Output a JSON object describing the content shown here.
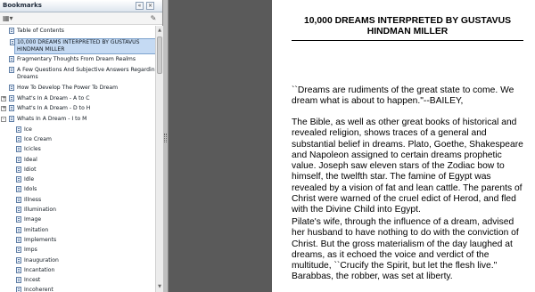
{
  "bookmarks": {
    "title": "Bookmarks",
    "items": [
      {
        "label": "Table of Contents",
        "level": 0,
        "expander": ""
      },
      {
        "label": "10,000 DREAMS INTERPRETED BY GUSTAVUS\nHINDMAN MILLER",
        "level": 0,
        "expander": "",
        "selected": true
      },
      {
        "label": "Fragmentary Thoughts From Dream Realms",
        "level": 0,
        "expander": ""
      },
      {
        "label": "A Few Questions And Subjective Answers Regarding\nDreams",
        "level": 0,
        "expander": ""
      },
      {
        "label": "How To Develop The Power To Dream",
        "level": 0,
        "expander": ""
      },
      {
        "label": "What's In A Dream - A to C",
        "level": 0,
        "expander": "+"
      },
      {
        "label": "What's In A Dream - D to H",
        "level": 0,
        "expander": "+"
      },
      {
        "label": "Whats In A Dream - I to M",
        "level": 0,
        "expander": "-"
      },
      {
        "label": "Ice",
        "level": 1,
        "expander": ""
      },
      {
        "label": "Ice Cream",
        "level": 1,
        "expander": ""
      },
      {
        "label": "Icicles",
        "level": 1,
        "expander": ""
      },
      {
        "label": "Ideal",
        "level": 1,
        "expander": ""
      },
      {
        "label": "Idiot",
        "level": 1,
        "expander": ""
      },
      {
        "label": "Idle",
        "level": 1,
        "expander": ""
      },
      {
        "label": "Idols",
        "level": 1,
        "expander": ""
      },
      {
        "label": "Illness",
        "level": 1,
        "expander": ""
      },
      {
        "label": "Illumination",
        "level": 1,
        "expander": ""
      },
      {
        "label": "Image",
        "level": 1,
        "expander": ""
      },
      {
        "label": "Imitation",
        "level": 1,
        "expander": ""
      },
      {
        "label": "Implements",
        "level": 1,
        "expander": ""
      },
      {
        "label": "Imps",
        "level": 1,
        "expander": ""
      },
      {
        "label": "Inauguration",
        "level": 1,
        "expander": ""
      },
      {
        "label": "Incantation",
        "level": 1,
        "expander": ""
      },
      {
        "label": "Incest",
        "level": 1,
        "expander": ""
      },
      {
        "label": "Incoherent",
        "level": 1,
        "expander": ""
      }
    ]
  },
  "document": {
    "title": "10,000 DREAMS INTERPRETED BY GUSTAVUS\nHINDMAN MILLER",
    "paragraphs": [
      "``Dreams are rudiments of the great state to come. We\ndream what is about to happen.\"--BAILEY,",
      "The Bible, as well as other great books of historical and\nrevealed religion, shows traces of a general and\nsubstantial belief in dreams. Plato, Goethe, Shakespeare\nand Napoleon assigned to certain dreams prophetic\nvalue. Joseph saw eleven stars of the Zodiac bow to\nhimself, the twelfth star. The famine of Egypt was\nrevealed by a vision of fat and lean cattle. The parents of\nChrist were warned of the cruel edict of Herod, and fled\nwith the Divine Child into Egypt.",
      "Pilate's wife, through the influence of a dream, advised\nher husband to have nothing to do with the conviction of\nChrist. But the gross materialism of the day laughed at\ndreams, as it echoed the voice and verdict of the\nmultitude, ``Crucify the Spirit, but let the flesh live.\"\nBarabbas, the robber, was set at liberty."
    ]
  },
  "icons": {
    "bookmark_item": "bookmark-page-icon",
    "expand": "plus-expander-icon",
    "collapse": "minus-expander-icon"
  },
  "colors": {
    "selection": "#c5daf3",
    "workspace": "#5a5a5a",
    "page": "#ffffff"
  }
}
